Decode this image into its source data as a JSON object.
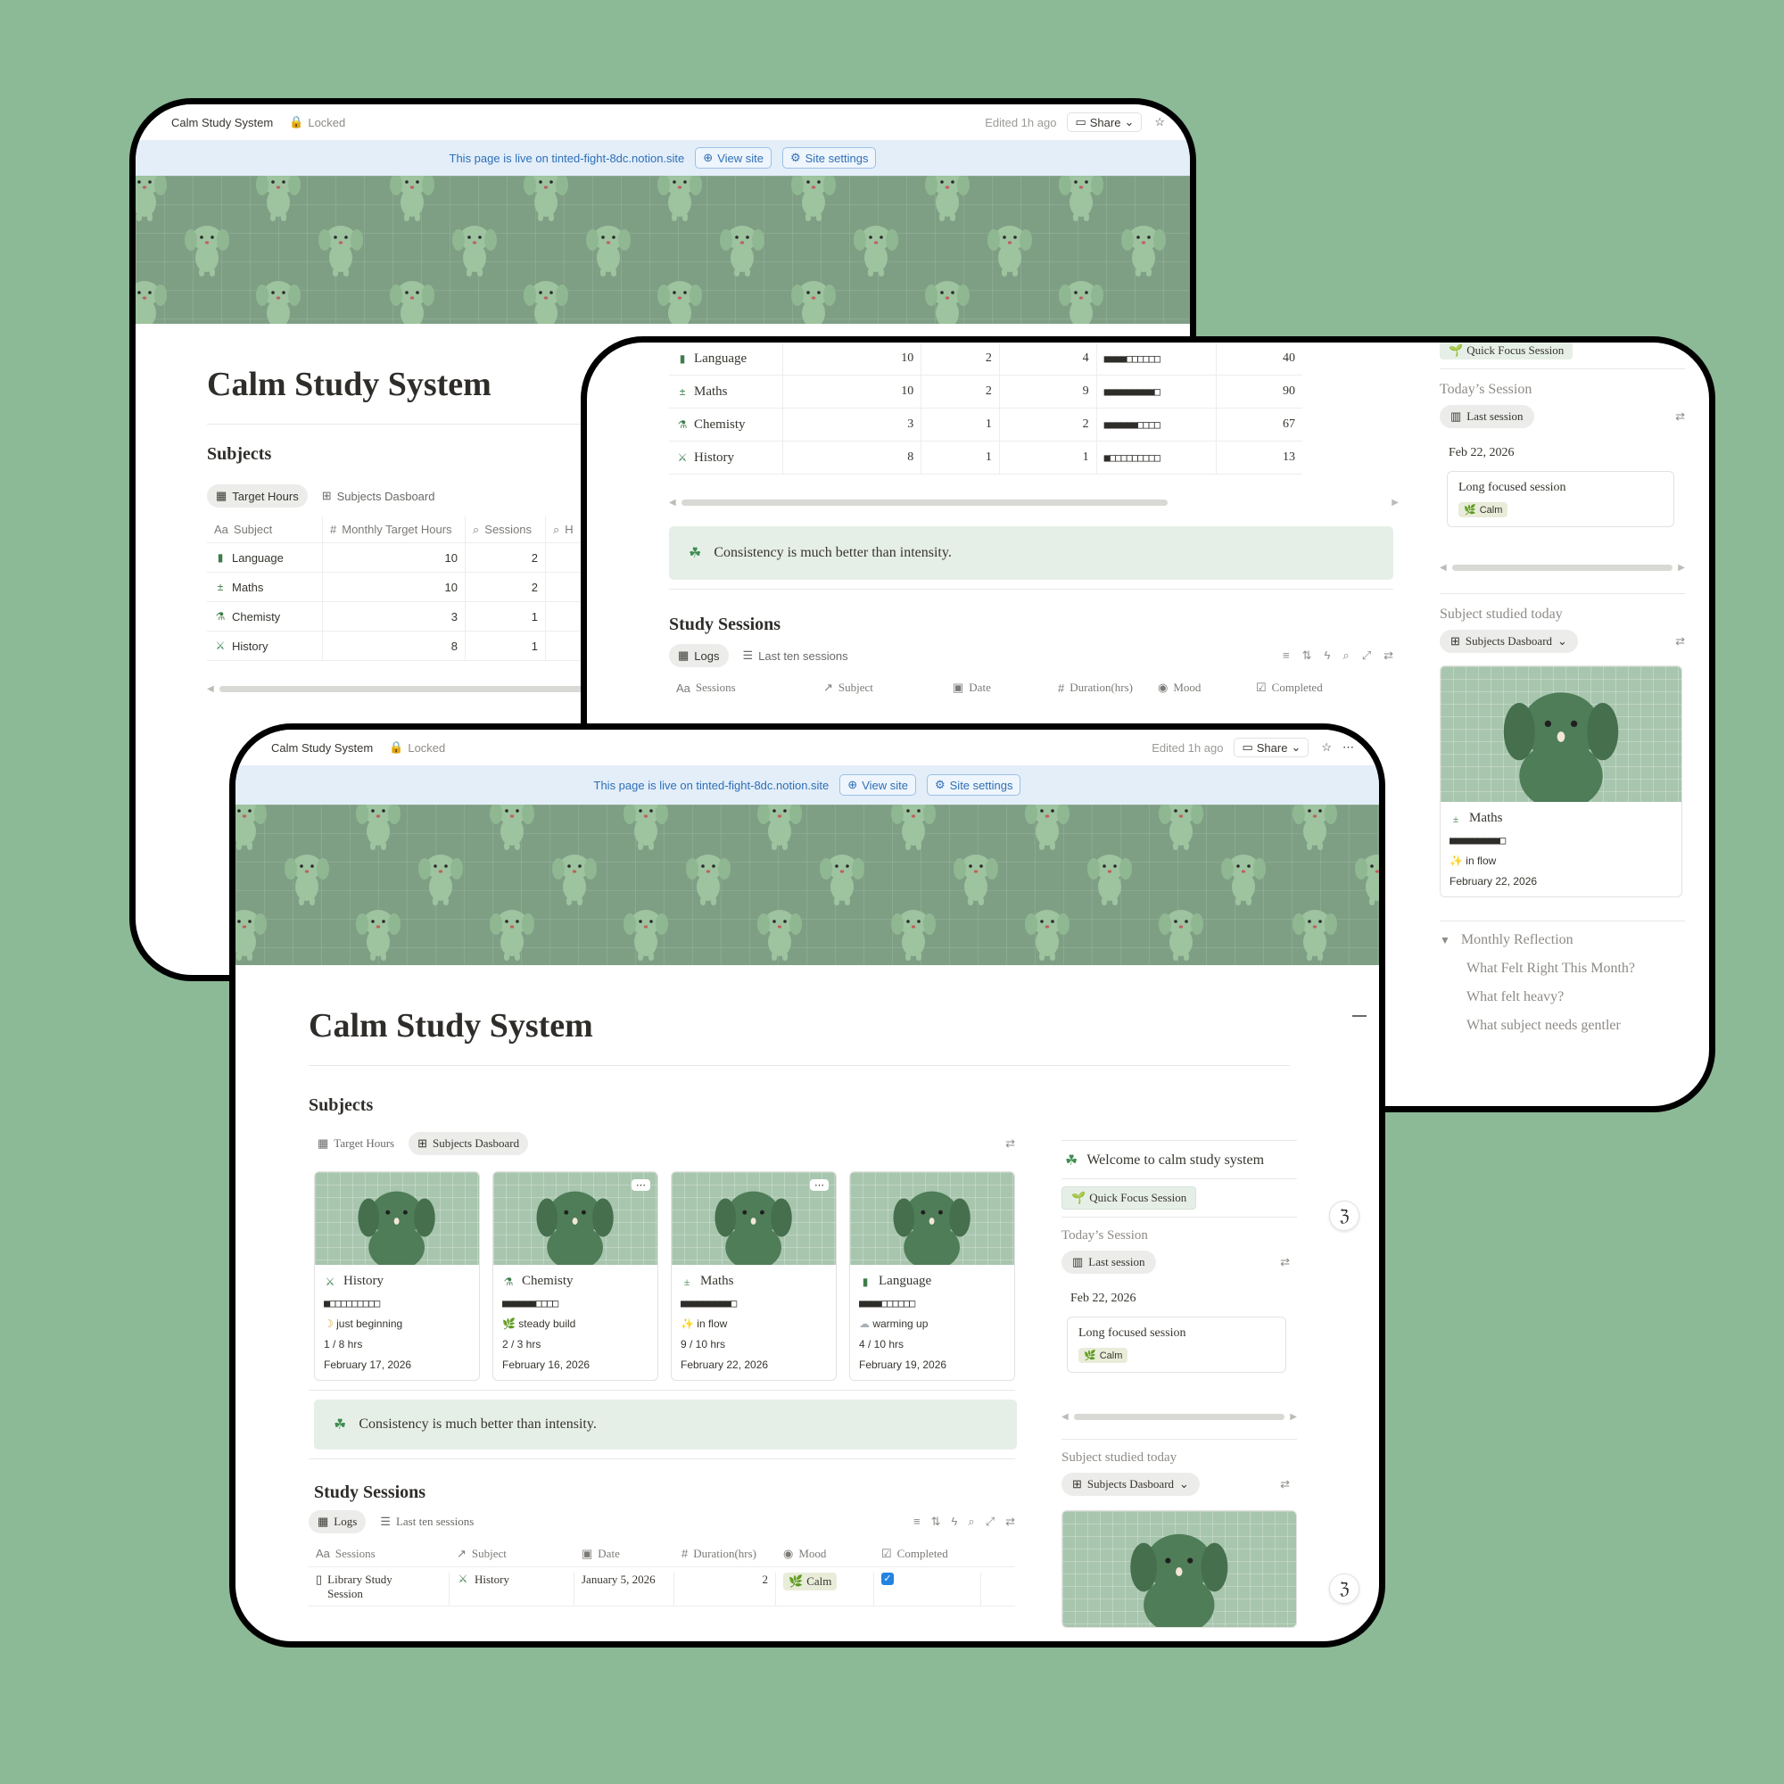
{
  "app": {
    "breadcrumb": "Calm Study System",
    "locked": "Locked",
    "edited": "Edited 1h ago",
    "share": "Share"
  },
  "banner": {
    "text": "This page is live on tinted-fight-8dc.notion.site",
    "view_site": "View site",
    "site_settings": "Site settings"
  },
  "page": {
    "title": "Calm Study System",
    "subjects_heading": "Subjects",
    "study_sessions_heading": "Study Sessions",
    "callout": "Consistency is much better than intensity."
  },
  "subject_tabs": [
    "Target Hours",
    "Subjects Dasboard"
  ],
  "subject_table": {
    "columns": [
      "Subject",
      "Monthly Target Hours",
      "Sessions",
      "H"
    ],
    "rows": [
      {
        "subject": "Language",
        "icon": "book-icon",
        "target": "10",
        "sessions": "2"
      },
      {
        "subject": "Maths",
        "icon": "math-icon",
        "target": "10",
        "sessions": "2"
      },
      {
        "subject": "Chemisty",
        "icon": "flask-icon",
        "target": "3",
        "sessions": "1"
      },
      {
        "subject": "History",
        "icon": "swords-icon",
        "target": "8",
        "sessions": "1"
      }
    ]
  },
  "progress_table": {
    "rows": [
      {
        "subject": "Language",
        "target": "10",
        "sessions": "2",
        "hours": "4",
        "bar": "■■■■□□□□□□",
        "pct": "40"
      },
      {
        "subject": "Maths",
        "target": "10",
        "sessions": "2",
        "hours": "9",
        "bar": "■■■■■■■■■□",
        "pct": "90"
      },
      {
        "subject": "Chemisty",
        "target": "3",
        "sessions": "1",
        "hours": "2",
        "bar": "■■■■■■□□□□",
        "pct": "67"
      },
      {
        "subject": "History",
        "target": "8",
        "sessions": "1",
        "hours": "1",
        "bar": "■□□□□□□□□□",
        "pct": "13"
      }
    ]
  },
  "session_tabs": [
    "Logs",
    "Last ten sessions"
  ],
  "session_table": {
    "columns": [
      "Sessions",
      "Subject",
      "Date",
      "Duration(hrs)",
      "Mood",
      "Completed"
    ],
    "rows": [
      {
        "session": "Library Study Session",
        "subject": "History",
        "date": "January 5, 2026",
        "duration": "2",
        "mood": "Calm",
        "completed": true
      }
    ]
  },
  "cards": [
    {
      "name": "History",
      "icon": "swords-icon",
      "bar": "■□□□□□□□□□",
      "status": "just beginning",
      "status_icon": "🌙",
      "hours": "1 / 8 hrs",
      "date": "February 17, 2026"
    },
    {
      "name": "Chemisty",
      "icon": "flask-icon",
      "bar": "■■■■■■□□□□",
      "status": "steady build",
      "status_icon": "🌿",
      "hours": "2 / 3 hrs",
      "date": "February 16, 2026"
    },
    {
      "name": "Maths",
      "icon": "math-icon",
      "bar": "■■■■■■■■■□",
      "status": "in flow",
      "status_icon": "✨",
      "hours": "9 / 10 hrs",
      "date": "February 22, 2026"
    },
    {
      "name": "Language",
      "icon": "book-icon",
      "bar": "■■■■□□□□□□",
      "status": "warming up",
      "status_icon": "☁",
      "hours": "4 / 10 hrs",
      "date": "February 19, 2026"
    }
  ],
  "sidebar": {
    "welcome": "Welcome to calm study system",
    "quick_focus": "Quick Focus Session",
    "todays_session": "Today’s Session",
    "last_session": "Last session",
    "session_date": "Feb 22, 2026",
    "session_title": "Long focused session",
    "session_mood": "Calm",
    "subject_today": "Subject studied today",
    "subjects_dash": "Subjects Dasboard",
    "today_card": {
      "name": "Maths",
      "bar": "■■■■■■■■■□",
      "status": "in flow",
      "date": "February 22, 2026"
    },
    "reflection": "Monthly Reflection",
    "reflection_items": [
      "What Felt Right This Month?",
      "What felt heavy?",
      "What subject needs gentler"
    ]
  },
  "colors": {
    "background": "#8cb996",
    "accent": "#3f8d52",
    "banner": "#e3eef9",
    "cover": "#7f9f85"
  }
}
